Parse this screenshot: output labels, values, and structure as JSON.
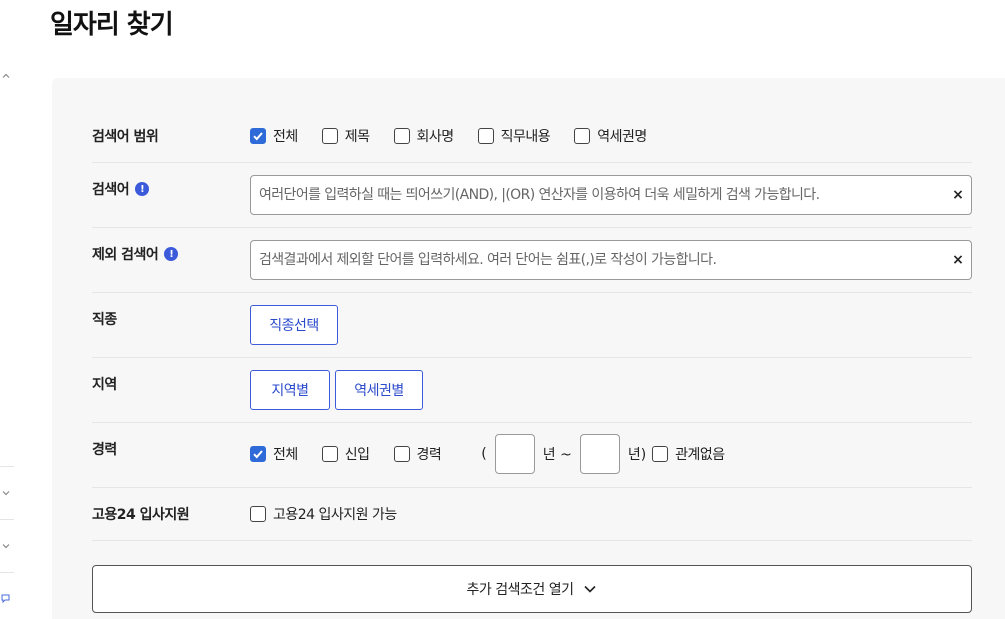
{
  "page": {
    "title": "일자리 찾기"
  },
  "scope": {
    "label": "검색어 범위",
    "options": [
      {
        "label": "전체",
        "checked": true
      },
      {
        "label": "제목",
        "checked": false
      },
      {
        "label": "회사명",
        "checked": false
      },
      {
        "label": "직무내용",
        "checked": false
      },
      {
        "label": "역세권명",
        "checked": false
      }
    ]
  },
  "keyword": {
    "label": "검색어",
    "placeholder": "여러단어를 입력하실 때는 띄어쓰기(AND), |(OR) 연산자를 이용하여 더욱 세밀하게 검색 가능합니다.",
    "value": "",
    "clear": "×"
  },
  "exclude": {
    "label": "제외 검색어",
    "placeholder": "검색결과에서 제외할 단어를 입력하세요. 여러 단어는 쉼표(,)로 작성이 가능합니다.",
    "value": "",
    "clear": "×"
  },
  "info_glyph": "!",
  "job_type": {
    "label": "직종",
    "button": "직종선택"
  },
  "region": {
    "label": "지역",
    "buttons": [
      "지역별",
      "역세권별"
    ]
  },
  "career": {
    "label": "경력",
    "options": [
      {
        "label": "전체",
        "checked": true
      },
      {
        "label": "신입",
        "checked": false
      },
      {
        "label": "경력",
        "checked": false
      }
    ],
    "open_paren": "(",
    "year_sep": "년 ~",
    "year_end": "년)",
    "irrelevant": {
      "label": "관계없음",
      "checked": false
    }
  },
  "employment24": {
    "label": "고용24 입사지원",
    "option": {
      "label": "고용24 입사지원 가능",
      "checked": false
    }
  },
  "more_button": {
    "label": "추가 검색조건 열기"
  },
  "colors": {
    "accent": "#2f6bd8",
    "button_border": "#3b5bdb",
    "panel_bg": "#f7f7f7"
  }
}
